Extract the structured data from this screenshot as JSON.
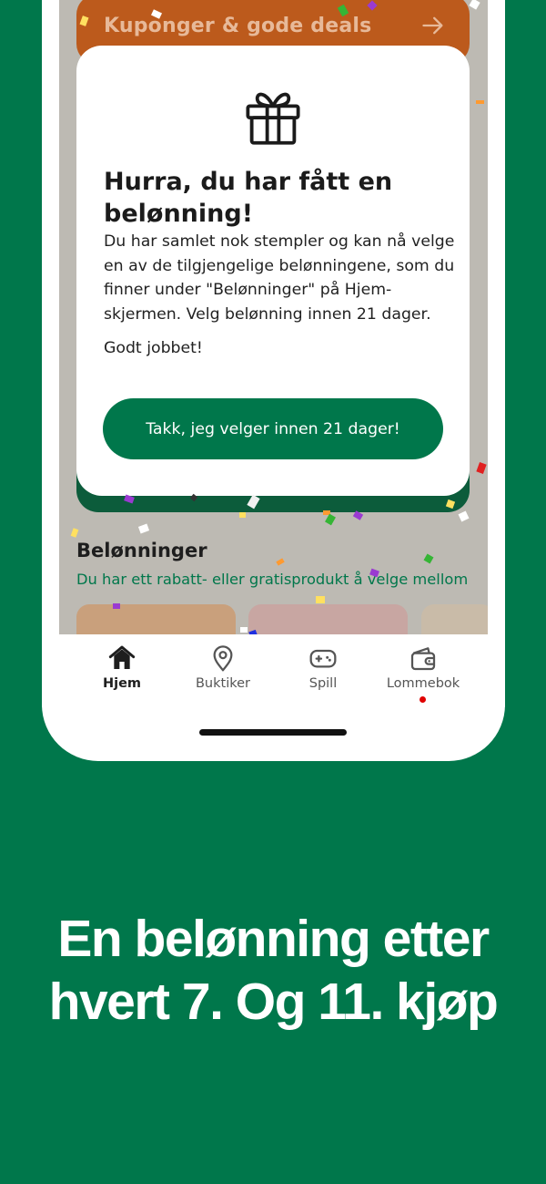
{
  "coupon_card": {
    "title": "Kuponger & gode deals",
    "icon": "arrow-right-icon"
  },
  "modal": {
    "icon": "gift-icon",
    "title": "Hurra, du har fått en belønning!",
    "body": "Du har samlet nok stempler og kan nå velge en av de tilgjengelige belønningene, som du finner under \"Belønninger\" på Hjem-skjermen. Velg belønning innen 21 dager.",
    "body2": "Godt jobbet!",
    "button_label": "Takk, jeg velger innen 21 dager!"
  },
  "rewards": {
    "title": "Belønninger",
    "subtitle": "Du har ett rabatt- eller gratisprodukt å velge mellom"
  },
  "nav": {
    "items": [
      {
        "label": "Hjem",
        "icon": "home-icon",
        "active": true
      },
      {
        "label": "Buktiker",
        "icon": "location-pin-icon",
        "active": false
      },
      {
        "label": "Spill",
        "icon": "gamepad-icon",
        "active": false
      },
      {
        "label": "Lommebok",
        "icon": "wallet-icon",
        "active": false,
        "badge": true
      }
    ]
  },
  "headline": {
    "line1": "En belønning etter",
    "line2": "hvert 7. Og 11. kjøp"
  },
  "colors": {
    "brand_green": "#00774b",
    "dark_green": "#0c5c3b",
    "coupon_orange": "#bc5a1c",
    "badge_red": "#e00000"
  }
}
